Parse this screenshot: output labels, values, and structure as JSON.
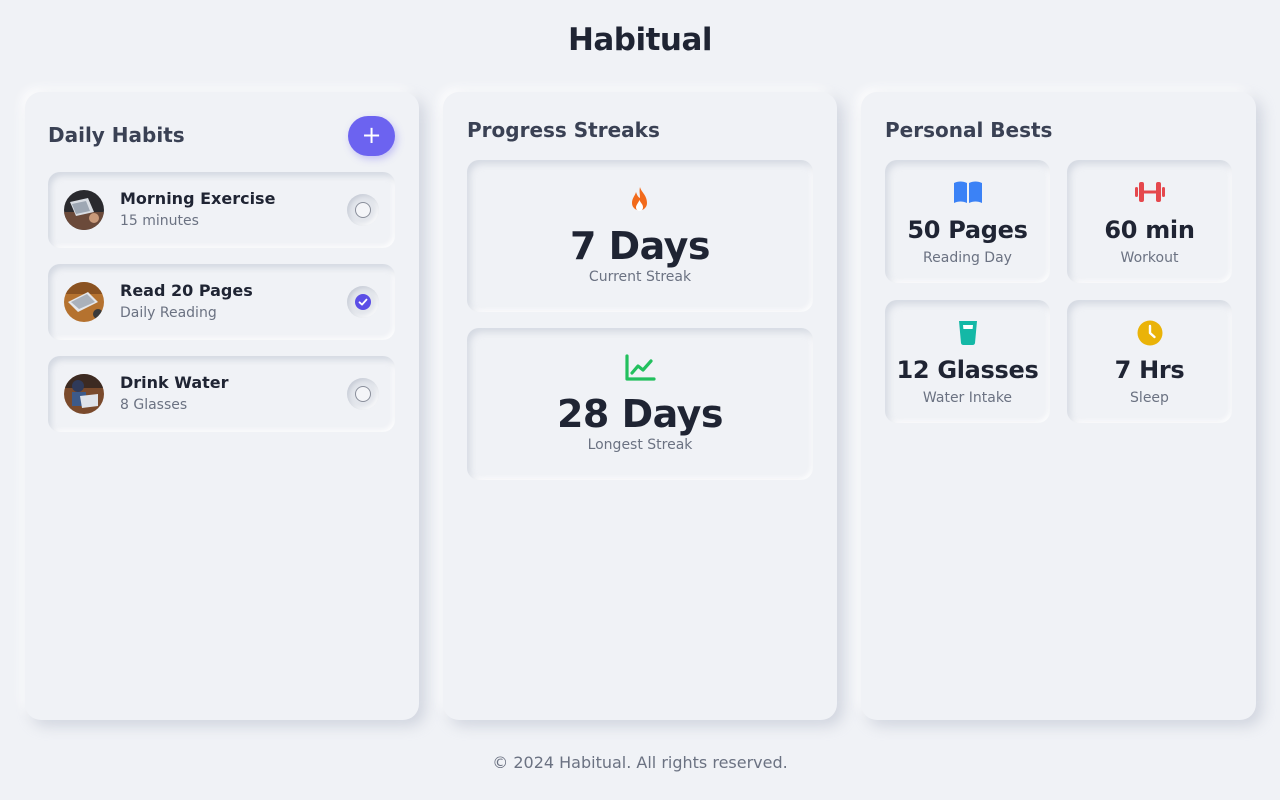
{
  "app": {
    "title": "Habitual"
  },
  "habits": {
    "title": "Daily Habits",
    "add_label": "+",
    "items": [
      {
        "name": "Morning Exercise",
        "detail": "15 minutes",
        "completed": false,
        "avatar": "laptop-desk-photo"
      },
      {
        "name": "Read 20 Pages",
        "detail": "Daily Reading",
        "completed": true,
        "avatar": "laptop-wood-table-photo"
      },
      {
        "name": "Drink Water",
        "detail": "8 Glasses",
        "completed": false,
        "avatar": "person-laptop-photo"
      }
    ]
  },
  "streaks": {
    "title": "Progress Streaks",
    "items": [
      {
        "value": "7 Days",
        "label": "Current Streak",
        "icon": "fire-icon",
        "color": "#f26a1b"
      },
      {
        "value": "28 Days",
        "label": "Longest Streak",
        "icon": "trend-chart-icon",
        "color": "#22c05e"
      }
    ]
  },
  "bests": {
    "title": "Personal Bests",
    "items": [
      {
        "value": "50 Pages",
        "label": "Reading Day",
        "icon": "book-icon",
        "color": "#3b82f6"
      },
      {
        "value": "60 min",
        "label": "Workout",
        "icon": "dumbbell-icon",
        "color": "#e5484d"
      },
      {
        "value": "12 Glasses",
        "label": "Water Intake",
        "icon": "glass-icon",
        "color": "#14b8a6"
      },
      {
        "value": "7 Hrs",
        "label": "Sleep",
        "icon": "clock-icon",
        "color": "#eab308"
      }
    ]
  },
  "colors": {
    "accent": "#6c63f0",
    "check": "#5b4ee6",
    "background": "#f0f2f6"
  },
  "footer": {
    "text": "© 2024 Habitual. All rights reserved."
  }
}
